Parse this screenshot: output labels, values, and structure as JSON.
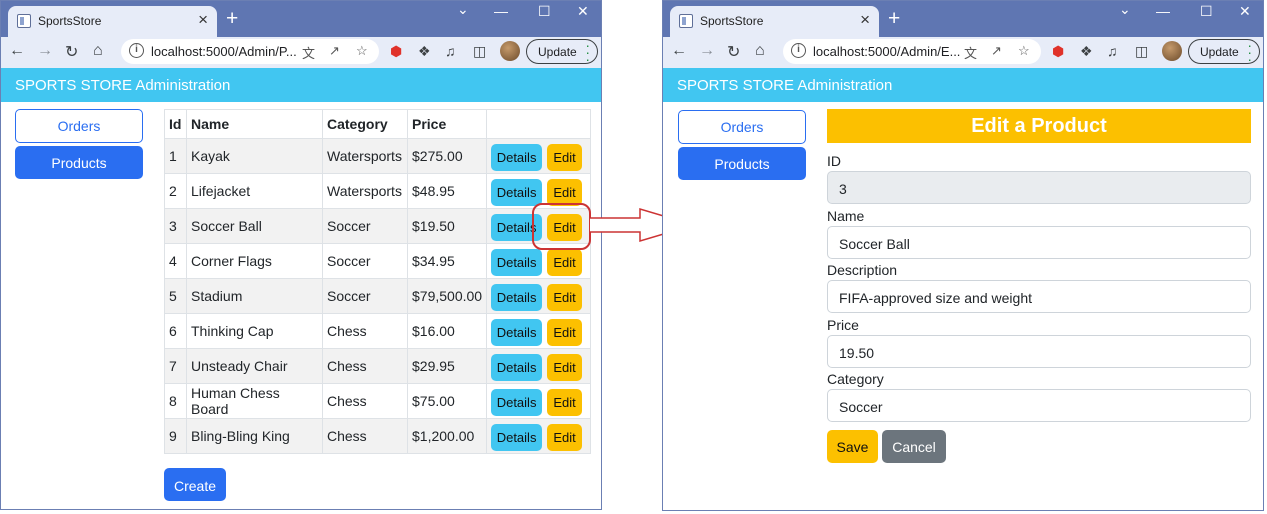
{
  "browser": {
    "tab_title": "SportsStore",
    "tab_close": "×",
    "new_tab": "+",
    "minimize": "⌄",
    "update_label": "Update"
  },
  "left": {
    "url": "localhost:5000/Admin/P...",
    "header": "SPORTS STORE Administration",
    "nav": {
      "orders": "Orders",
      "products": "Products"
    },
    "table": {
      "headers": [
        "Id",
        "Name",
        "Category",
        "Price"
      ],
      "rows": [
        [
          "1",
          "Kayak",
          "Watersports",
          "$275.00"
        ],
        [
          "2",
          "Lifejacket",
          "Watersports",
          "$48.95"
        ],
        [
          "3",
          "Soccer Ball",
          "Soccer",
          "$19.50"
        ],
        [
          "4",
          "Corner Flags",
          "Soccer",
          "$34.95"
        ],
        [
          "5",
          "Stadium",
          "Soccer",
          "$79,500.00"
        ],
        [
          "6",
          "Thinking Cap",
          "Chess",
          "$16.00"
        ],
        [
          "7",
          "Unsteady Chair",
          "Chess",
          "$29.95"
        ],
        [
          "8",
          "Human Chess Board",
          "Chess",
          "$75.00"
        ],
        [
          "9",
          "Bling-Bling King",
          "Chess",
          "$1,200.00"
        ]
      ],
      "details_label": "Details",
      "edit_label": "Edit"
    },
    "create_label": "Create"
  },
  "right": {
    "url": "localhost:5000/Admin/E...",
    "header": "SPORTS STORE Administration",
    "nav": {
      "orders": "Orders",
      "products": "Products"
    },
    "form": {
      "title": "Edit a Product",
      "id_label": "ID",
      "id_value": "3",
      "name_label": "Name",
      "name_value": "Soccer Ball",
      "description_label": "Description",
      "description_value": "FIFA-approved size and weight",
      "price_label": "Price",
      "price_value": "19.50",
      "category_label": "Category",
      "category_value": "Soccer",
      "save_label": "Save",
      "cancel_label": "Cancel"
    }
  },
  "colors": {
    "header": "#41c6f1",
    "primary": "#2a6ef1",
    "warning": "#fcc000",
    "info": "#41c6f1",
    "secondary": "#6c757d",
    "arrow": "#cc3333"
  }
}
